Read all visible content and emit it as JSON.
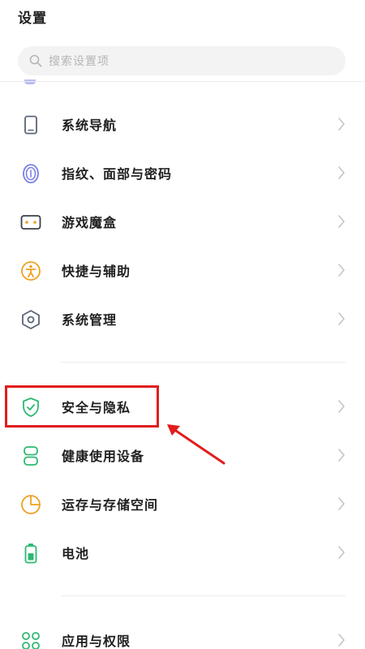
{
  "header": {
    "title": "设置"
  },
  "search": {
    "placeholder": "搜索设置项"
  },
  "items": [
    {
      "label": "系统导航",
      "icon": "phone-outline-icon",
      "color": "#5b6478"
    },
    {
      "label": "指纹、面部与密码",
      "icon": "fingerprint-icon",
      "color": "#7b7fe3"
    },
    {
      "label": "游戏魔盒",
      "icon": "gamepad-icon",
      "color": "#3b3f4a"
    },
    {
      "label": "快捷与辅助",
      "icon": "accessibility-icon",
      "color": "#f0a020"
    },
    {
      "label": "系统管理",
      "icon": "hexagon-settings-icon",
      "color": "#5b6478"
    },
    {
      "label": "安全与隐私",
      "icon": "shield-check-icon",
      "color": "#2eb872"
    },
    {
      "label": "健康使用设备",
      "icon": "hourglass-icon",
      "color": "#2eb872"
    },
    {
      "label": "运存与存储空间",
      "icon": "pie-chart-icon",
      "color": "#f0a020"
    },
    {
      "label": "电池",
      "icon": "battery-icon",
      "color": "#2eb872"
    },
    {
      "label": "应用与权限",
      "icon": "apps-grid-icon",
      "color": "#2eb872"
    }
  ],
  "annotation": {
    "highlight_color": "#e11d1d",
    "highlighted_item": "安全与隐私"
  }
}
